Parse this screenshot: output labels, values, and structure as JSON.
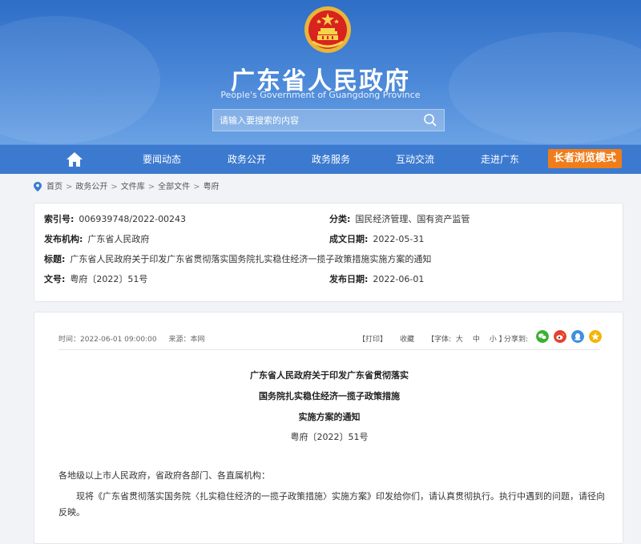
{
  "header": {
    "title": "广东省人民政府",
    "subtitle": "People's Government of Guangdong Province",
    "search_placeholder": "请输入要搜索的内容"
  },
  "nav": {
    "items": [
      "要闻动态",
      "政务公开",
      "政务服务",
      "互动交流",
      "走进广东"
    ],
    "elder_mode": "长者浏览模式"
  },
  "breadcrumb": [
    "首页",
    "政务公开",
    "文件库",
    "全部文件",
    "粤府"
  ],
  "meta": {
    "index_label": "索引号:",
    "index_value": "006939748/2022-00243",
    "category_label": "分类:",
    "category_value": "国民经济管理、国有资产监管",
    "issuer_label": "发布机构:",
    "issuer_value": "广东省人民政府",
    "created_label": "成文日期:",
    "created_value": "2022-05-31",
    "title_label": "标题:",
    "title_value": "广东省人民政府关于印发广东省贯彻落实国务院扎实稳住经济一揽子政策措施实施方案的通知",
    "docno_label": "文号:",
    "docno_value": "粤府〔2022〕51号",
    "published_label": "发布日期:",
    "published_value": "2022-06-01"
  },
  "article": {
    "time": "时间：2022-06-01 09:00:00",
    "source": "来源：本网",
    "print": "【打印】",
    "favorite": "收藏",
    "font_size_prefix": "【字体:",
    "font_large": "大",
    "font_medium": "中",
    "font_small": "小",
    "font_size_suffix": "】",
    "share_label": "分享到:",
    "title_lines": [
      "广东省人民政府关于印发广东省贯彻落实",
      "国务院扎实稳住经济一揽子政策措施",
      "实施方案的通知"
    ],
    "doc_number": "粤府〔2022〕51号",
    "salutation": "各地级以上市人民政府，省政府各部门、各直属机构：",
    "body_line1": "现将《广东省贯彻落实国务院〈扎实稳住经济的一揽子政策措施〉实施方案》印发给你们，请认真贯彻执行。执行中遇到的问题，请径向省发展改革委",
    "body_line2": "反映。"
  },
  "colors": {
    "header_blue": "#3c7ad0",
    "elder_orange": "#f07d1a",
    "wechat": "#3cb034",
    "weibo": "#e5402f",
    "qq": "#3d8fe0",
    "qzone": "#f5b400"
  }
}
